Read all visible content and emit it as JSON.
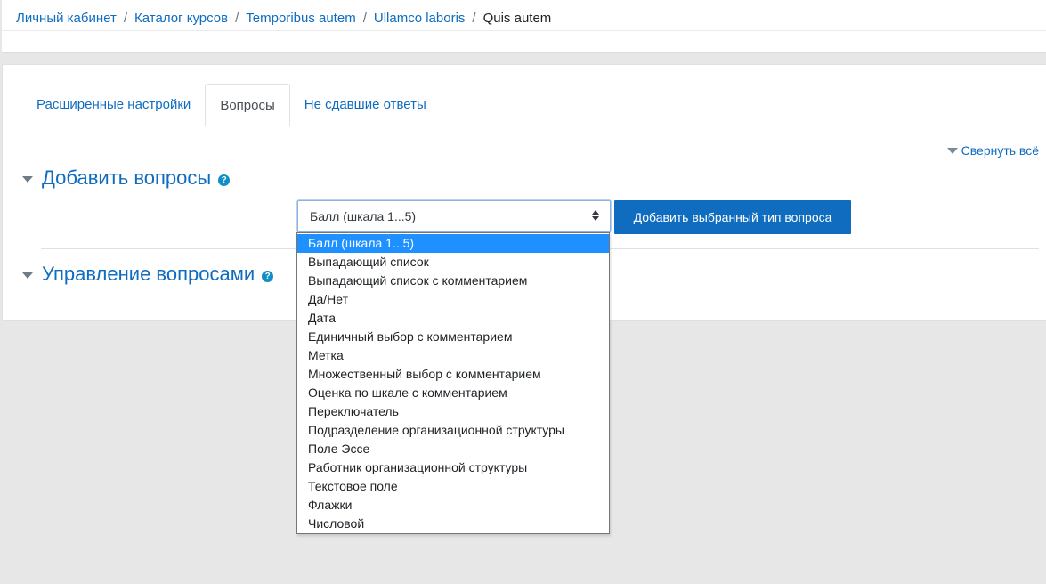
{
  "breadcrumb": {
    "items": [
      "Личный кабинет",
      "Каталог курсов",
      "Temporibus autem",
      "Ullamco laboris"
    ],
    "current": "Quis autem",
    "separator": "/"
  },
  "tabs": [
    {
      "label": "Расширенные настройки",
      "active": false
    },
    {
      "label": "Вопросы",
      "active": true
    },
    {
      "label": "Не сдавшие ответы",
      "active": false
    }
  ],
  "collapse_all": "Свернуть всё",
  "sections": {
    "add_questions": {
      "title": "Добавить вопросы",
      "help": "?"
    },
    "manage_questions": {
      "title": "Управление вопросами",
      "help": "?"
    }
  },
  "question_type_select": {
    "selected": "Балл (шкала 1...5)",
    "options": [
      "Балл (шкала 1...5)",
      "Выпадающий список",
      "Выпадающий список с комментарием",
      "Да/Нет",
      "Дата",
      "Единичный выбор с комментарием",
      "Метка",
      "Множественный выбор с комментарием",
      "Оценка по шкале с комментарием",
      "Переключатель",
      "Подразделение организационной структуры",
      "Поле Эссе",
      "Работник организационной структуры",
      "Текстовое поле",
      "Флажки",
      "Числовой"
    ],
    "highlighted_index": 0
  },
  "add_button_label": "Добавить выбранный тип вопроса",
  "colors": {
    "accent": "#0f6cbf",
    "highlight": "#1e90ff",
    "background": "#e7e7e7"
  }
}
